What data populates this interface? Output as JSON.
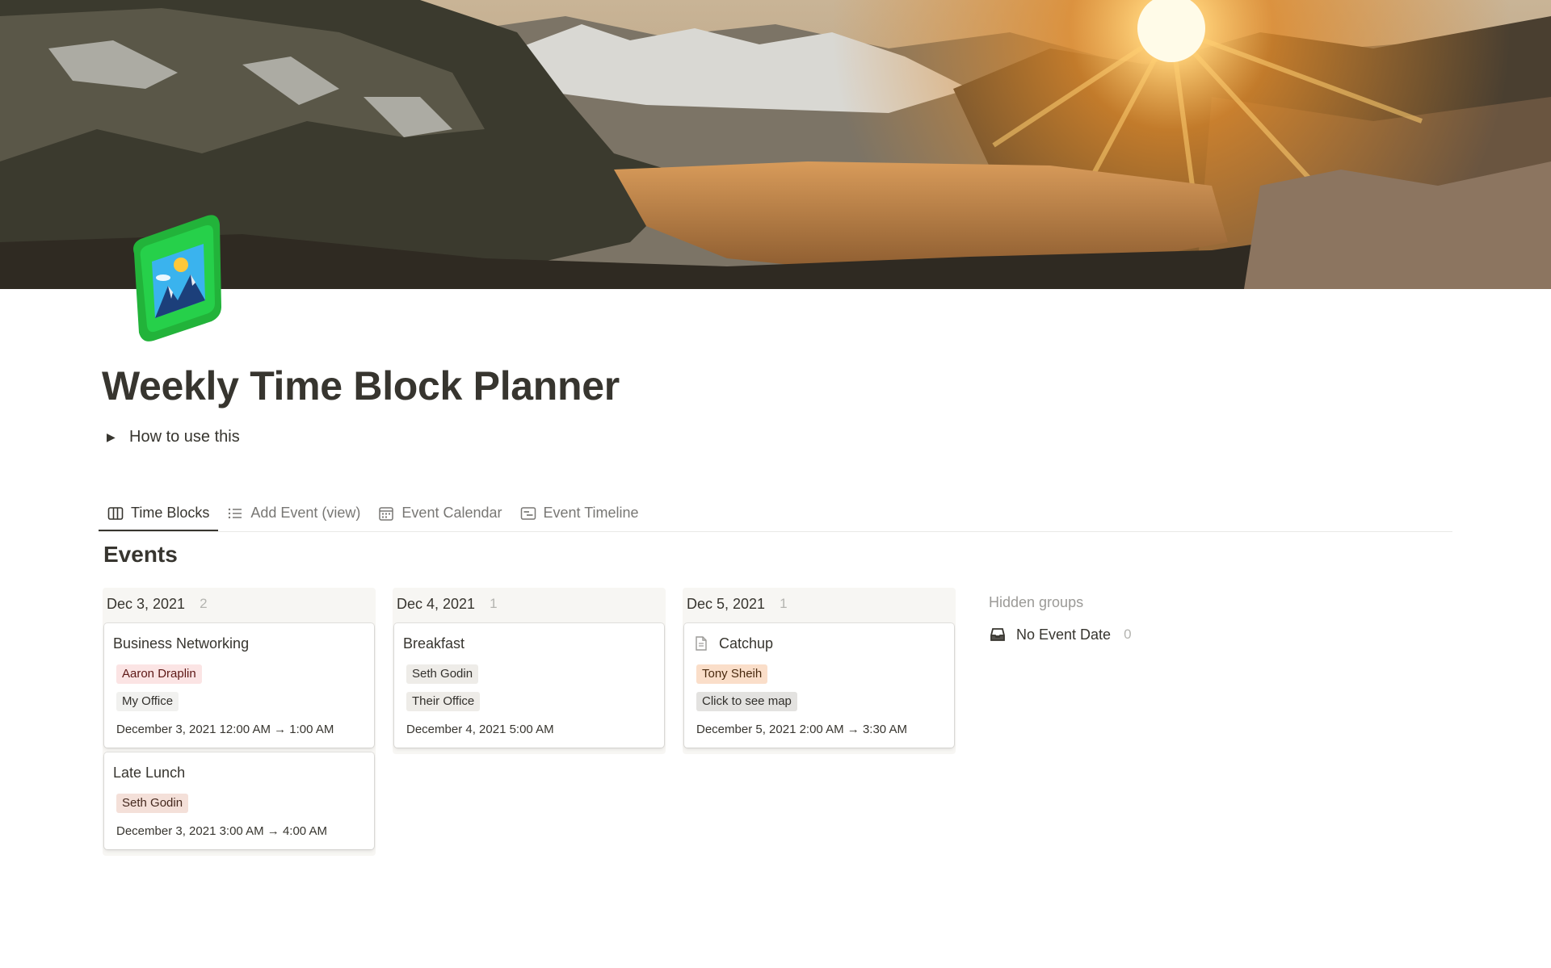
{
  "page": {
    "title": "Weekly Time Block Planner",
    "toggle_label": "How to use this",
    "icon": "mountain-map-icon"
  },
  "tabs": [
    {
      "label": "Time Blocks",
      "icon": "board-icon",
      "active": true
    },
    {
      "label": "Add Event (view)",
      "icon": "list-icon",
      "active": false
    },
    {
      "label": "Event Calendar",
      "icon": "calendar-icon",
      "active": false
    },
    {
      "label": "Event Timeline",
      "icon": "timeline-icon",
      "active": false
    }
  ],
  "database": {
    "title": "Events",
    "columns": [
      {
        "label": "Dec 3, 2021",
        "count": "2",
        "cards": [
          {
            "title": "Business Networking",
            "person": {
              "label": "Aaron Draplin",
              "bg": "#fbe4e4",
              "color": "#5d1715"
            },
            "location": {
              "label": "My Office",
              "bg": "#f1f1ef",
              "color": "#32302c"
            },
            "date": "December 3, 2021 12:00 AM → 1:00 AM"
          },
          {
            "title": "Late Lunch",
            "person": {
              "label": "Seth Godin",
              "bg": "#f4e0d9",
              "color": "#44281e"
            },
            "date": "December 3, 2021 3:00 AM → 4:00 AM"
          }
        ]
      },
      {
        "label": "Dec 4, 2021",
        "count": "1",
        "cards": [
          {
            "title": "Breakfast",
            "person": {
              "label": "Seth Godin",
              "bg": "#eeece8",
              "color": "#32302c"
            },
            "location": {
              "label": "Their Office",
              "bg": "#eeece8",
              "color": "#32302c"
            },
            "date": "December 4, 2021 5:00 AM"
          }
        ]
      },
      {
        "label": "Dec 5, 2021",
        "count": "1",
        "cards": [
          {
            "title": "Catchup",
            "has_page_icon": true,
            "person": {
              "label": "Tony Sheih",
              "bg": "#fadec9",
              "color": "#49290e"
            },
            "location": {
              "label": "Click to see map",
              "bg": "#e3e2e0",
              "color": "#32302c"
            },
            "date": "December 5, 2021 2:00 AM → 3:30 AM"
          }
        ]
      }
    ],
    "hidden_groups": {
      "label": "Hidden groups",
      "items": [
        {
          "label": "No Event Date",
          "count": "0",
          "icon": "inbox-icon"
        }
      ]
    }
  }
}
